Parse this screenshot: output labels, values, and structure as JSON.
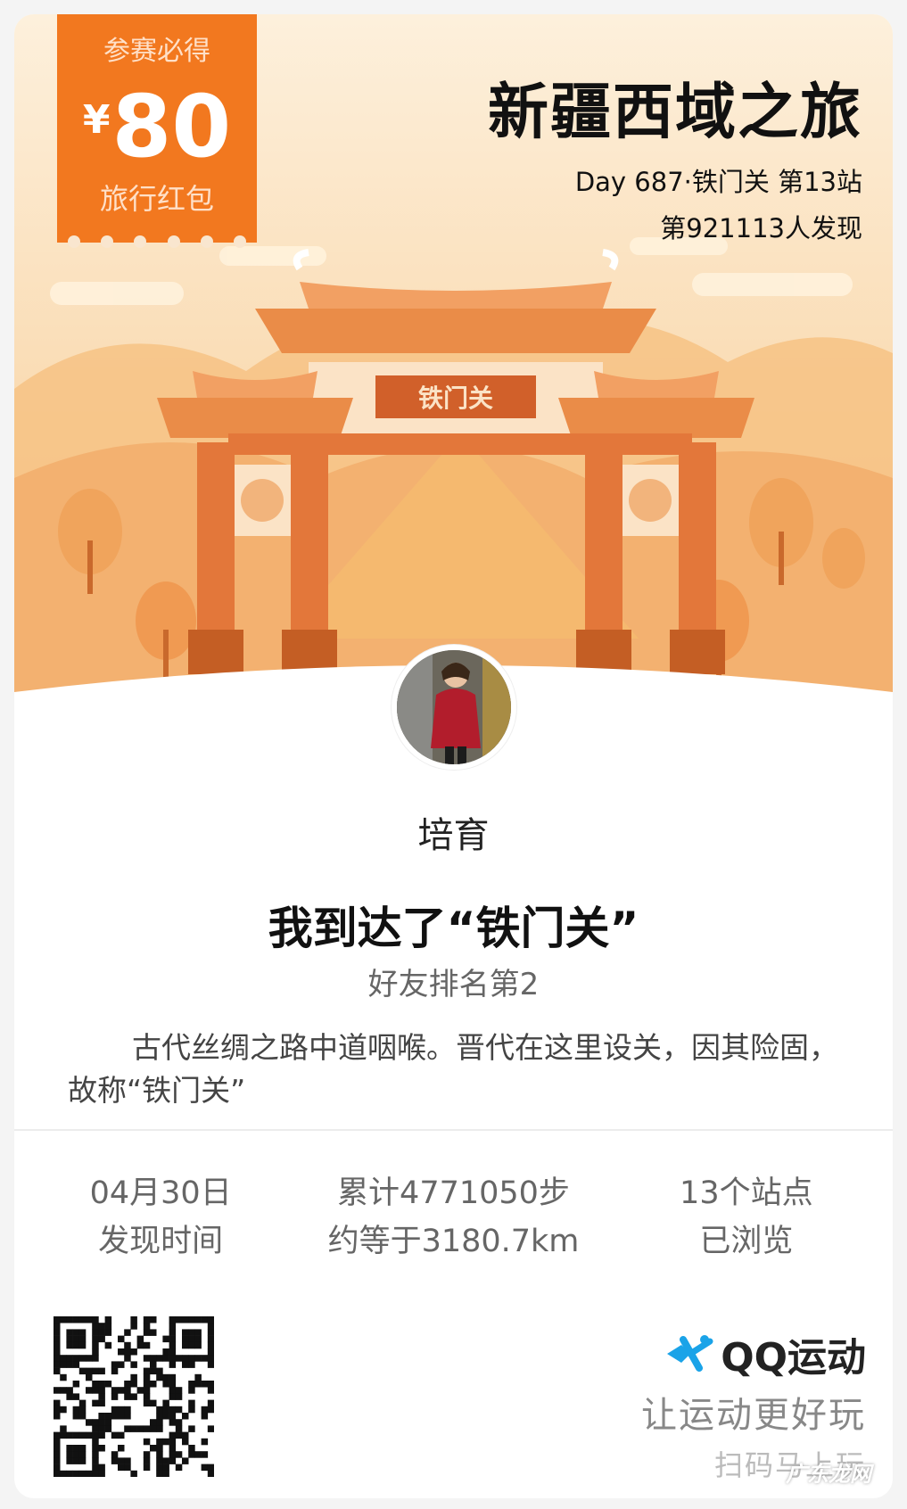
{
  "badge": {
    "top": "参赛必得",
    "currency": "¥",
    "amount": "80",
    "bottom": "旅行红包"
  },
  "trip": {
    "title": "新疆西域之旅",
    "day_station": "Day 687·铁门关 第13站",
    "discoverer": "第921113人发现"
  },
  "gate": {
    "plaque": "铁门关"
  },
  "user": {
    "name": "培育"
  },
  "headline": "我到达了“铁门关”",
  "rank": "好友排名第2",
  "description": "古代丝绸之路中道咽喉。晋代在这里设关，因其险固，故称“铁门关”",
  "stats": [
    {
      "value": "04月30日",
      "label": "发现时间"
    },
    {
      "value": "累计4771050步",
      "label": "约等于3180.7km"
    },
    {
      "value": "13个站点",
      "label": "已浏览"
    }
  ],
  "brand": {
    "name": "QQ运动",
    "slogan": "让运动更好玩",
    "cta": "扫码马上玩"
  },
  "watermark": "广东龙网",
  "colors": {
    "accent": "#f2781f",
    "gate": "#e3773a",
    "sky": "#fbe8c8"
  },
  "icons": [
    "qq-sport-logo-icon",
    "qr-code-icon"
  ]
}
